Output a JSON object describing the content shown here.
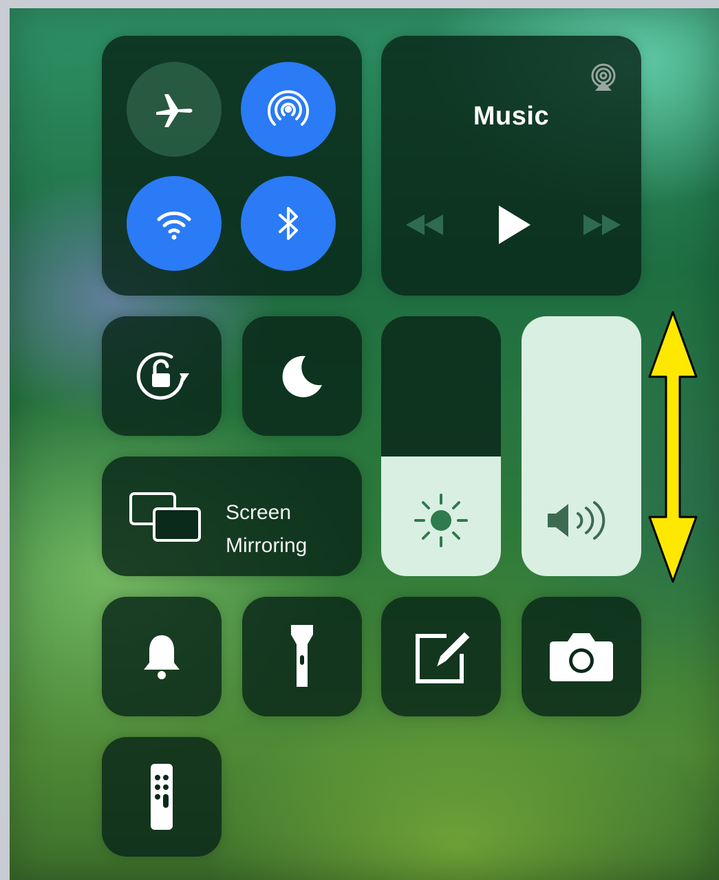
{
  "music": {
    "title": "Music",
    "airplay_icon": "airplay-audio-icon",
    "controls": [
      "rewind-icon",
      "play-icon",
      "fast-forward-icon"
    ]
  },
  "connectivity": [
    {
      "name": "airplane-mode",
      "icon": "airplane-icon",
      "active": false
    },
    {
      "name": "airdrop",
      "icon": "airdrop-icon",
      "active": true
    },
    {
      "name": "wifi",
      "icon": "wifi-icon",
      "active": true
    },
    {
      "name": "bluetooth",
      "icon": "bluetooth-icon",
      "active": true
    }
  ],
  "toggles": [
    {
      "name": "orientation-lock",
      "icon": "rotation-lock-icon"
    },
    {
      "name": "do-not-disturb",
      "icon": "moon-icon"
    }
  ],
  "screen_mirroring": {
    "line1": "Screen",
    "line2": "Mirroring",
    "icon": "screen-mirroring-icon"
  },
  "brightness": {
    "level": 0.46,
    "icon": "sun-icon"
  },
  "volume": {
    "level": 1.0,
    "icon": "speaker-volume-icon"
  },
  "bottom_row": [
    {
      "name": "alarm",
      "icon": "bell-icon"
    },
    {
      "name": "flashlight",
      "icon": "flashlight-icon"
    },
    {
      "name": "notes",
      "icon": "notes-icon"
    },
    {
      "name": "camera",
      "icon": "camera-icon"
    },
    {
      "name": "apple-tv-remote",
      "icon": "remote-icon"
    }
  ],
  "annotation": {
    "type": "double-arrow",
    "color": "#ffe800",
    "outline": "#000000"
  },
  "colors": {
    "active_blue": "#2a7bf5",
    "tile_dark": "#082618",
    "slider_fill": "#d9efe2"
  }
}
